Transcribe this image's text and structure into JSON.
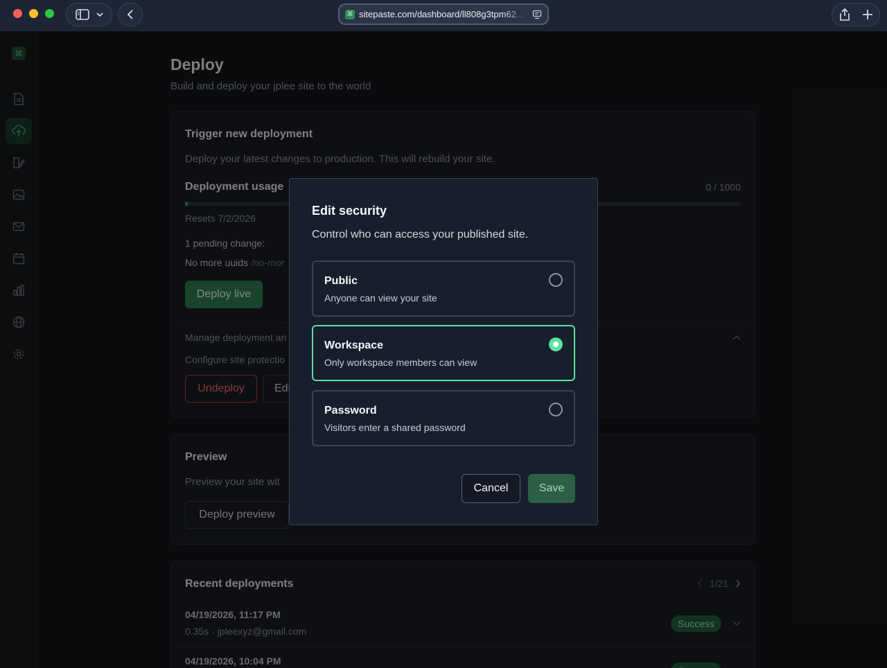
{
  "browser": {
    "url": "sitepaste.com/dashboard/ll808g3tpm62..."
  },
  "page": {
    "title": "Deploy",
    "subtitle": "Build and deploy your jplee site to the world"
  },
  "trigger": {
    "title": "Trigger new deployment",
    "description": "Deploy your latest changes to production. This will rebuild your site.",
    "usage_label": "Deployment usage",
    "usage_count": "0 / 1000",
    "usage_fraction": 0.004,
    "resets": "Resets 7/2/2026",
    "pending_label": "1 pending change:",
    "pending_item": "No more uuids",
    "pending_path": "/no-mor",
    "deploy_button": "Deploy live",
    "manage_text": "Manage deployment an",
    "configure_text": "Configure site protectio",
    "undeploy_button": "Undeploy",
    "edit_button": "Edi"
  },
  "preview": {
    "title": "Preview",
    "description": "Preview your site wit",
    "deploy_button": "Deploy preview"
  },
  "recent": {
    "title": "Recent deployments",
    "pager": "1/21",
    "items": [
      {
        "date": "04/19/2026, 11:17 PM",
        "meta": "0.35s · jpleexyz@gmail.com",
        "status": "Success"
      },
      {
        "date": "04/19/2026, 10:04 PM",
        "meta": "",
        "status": "Success"
      }
    ]
  },
  "modal": {
    "title": "Edit security",
    "description": "Control who can access your published site.",
    "options": [
      {
        "title": "Public",
        "description": "Anyone can view your site",
        "selected": false
      },
      {
        "title": "Workspace",
        "description": "Only workspace members can view",
        "selected": true
      },
      {
        "title": "Password",
        "description": "Visitors enter a shared password",
        "selected": false
      }
    ],
    "cancel_label": "Cancel",
    "save_label": "Save"
  },
  "colors": {
    "accent": "#5ee0a0",
    "success": "#2e7d4f",
    "danger": "#c23b3b"
  }
}
